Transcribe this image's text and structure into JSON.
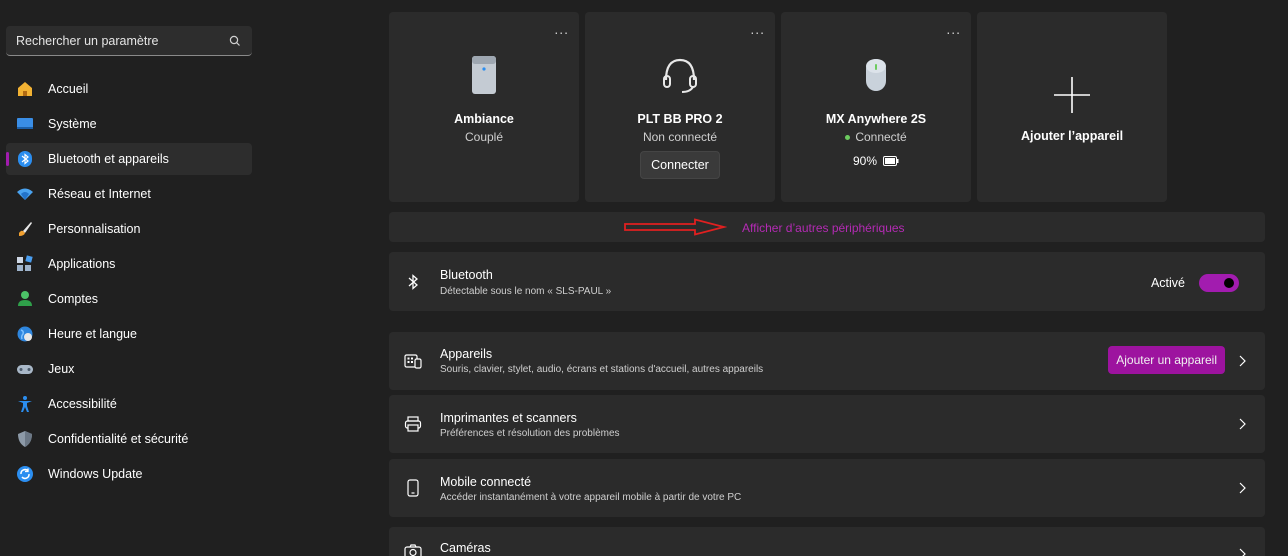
{
  "search": {
    "placeholder": "Rechercher un paramètre",
    "icon": "search-icon"
  },
  "sidebar": {
    "items": [
      {
        "label": "Accueil",
        "icon": "home-icon",
        "active": false
      },
      {
        "label": "Système",
        "icon": "system-icon",
        "active": false
      },
      {
        "label": "Bluetooth et appareils",
        "icon": "bluetooth-icon",
        "active": true
      },
      {
        "label": "Réseau et Internet",
        "icon": "wifi-icon",
        "active": false
      },
      {
        "label": "Personnalisation",
        "icon": "brush-icon",
        "active": false
      },
      {
        "label": "Applications",
        "icon": "apps-icon",
        "active": false
      },
      {
        "label": "Comptes",
        "icon": "account-icon",
        "active": false
      },
      {
        "label": "Heure et langue",
        "icon": "globe-icon",
        "active": false
      },
      {
        "label": "Jeux",
        "icon": "gamepad-icon",
        "active": false
      },
      {
        "label": "Accessibilité",
        "icon": "accessibility-icon",
        "active": false
      },
      {
        "label": "Confidentialité et sécurité",
        "icon": "shield-icon",
        "active": false
      },
      {
        "label": "Windows Update",
        "icon": "update-icon",
        "active": false
      }
    ]
  },
  "devices": [
    {
      "name": "Ambiance",
      "status": "Couplé",
      "icon": "speaker-icon",
      "more": "..."
    },
    {
      "name": "PLT BB PRO 2",
      "status": "Non connecté",
      "icon": "headset-icon",
      "more": "...",
      "button": "Connecter"
    },
    {
      "name": "MX Anywhere 2S",
      "status": "Connecté",
      "icon": "mouse-icon",
      "more": "...",
      "battery": "90%"
    }
  ],
  "add_device_card": {
    "label": "Ajouter l’appareil",
    "icon": "plus-icon"
  },
  "show_more": {
    "label": "Afficher d’autres périphériques"
  },
  "bluetooth": {
    "title": "Bluetooth",
    "subtitle": "Détectable sous le nom « SLS-PAUL »",
    "toggle_label": "Activé",
    "enabled": true
  },
  "rows": [
    {
      "title": "Appareils",
      "subtitle": "Souris, clavier, stylet, audio, écrans et stations d'accueil, autres appareils",
      "icon": "keyboard-icon",
      "button": "Ajouter un appareil"
    },
    {
      "title": "Imprimantes et scanners",
      "subtitle": "Préférences et résolution des problèmes",
      "icon": "printer-icon"
    },
    {
      "title": "Mobile connecté",
      "subtitle": "Accéder instantanément à votre appareil mobile à partir de votre PC",
      "icon": "phone-icon"
    },
    {
      "title": "Caméras",
      "icon": "camera-icon"
    }
  ],
  "colors": {
    "accent": "#a21caf",
    "background": "#202020",
    "card": "#2b2b2b",
    "link": "#b42ab4",
    "arrow": "#e02020"
  }
}
